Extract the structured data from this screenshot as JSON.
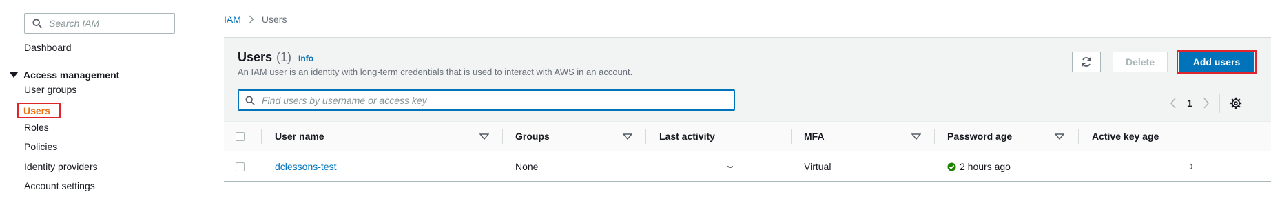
{
  "sidebar": {
    "search_placeholder": "Search IAM",
    "dashboard": "Dashboard",
    "section": "Access management",
    "items": [
      {
        "label": "User groups"
      },
      {
        "label": "Users"
      },
      {
        "label": "Roles"
      },
      {
        "label": "Policies"
      },
      {
        "label": "Identity providers"
      },
      {
        "label": "Account settings"
      }
    ],
    "active_item": "Users"
  },
  "breadcrumb": {
    "root": "IAM",
    "current": "Users"
  },
  "panel": {
    "title": "Users",
    "count": "(1)",
    "info": "Info",
    "description": "An IAM user is an identity with long-term credentials that is used to interact with AWS in an account.",
    "delete_label": "Delete",
    "add_label": "Add users",
    "filter_placeholder": "Find users by username or access key",
    "page": "1"
  },
  "table": {
    "columns": [
      "User name",
      "Groups",
      "Last activity",
      "MFA",
      "Password age",
      "Active key age"
    ],
    "rows": [
      {
        "user_name": "dclessons-test",
        "groups": "None",
        "last_activity": "",
        "mfa": "Virtual",
        "password_age": "2 hours ago",
        "active_key_age": ""
      }
    ]
  },
  "colors": {
    "link": "#0073bb",
    "primary_button": "#0073bb",
    "highlight_border": "#e0242c",
    "active_nav": "#ec7211",
    "success": "#1d8102"
  }
}
